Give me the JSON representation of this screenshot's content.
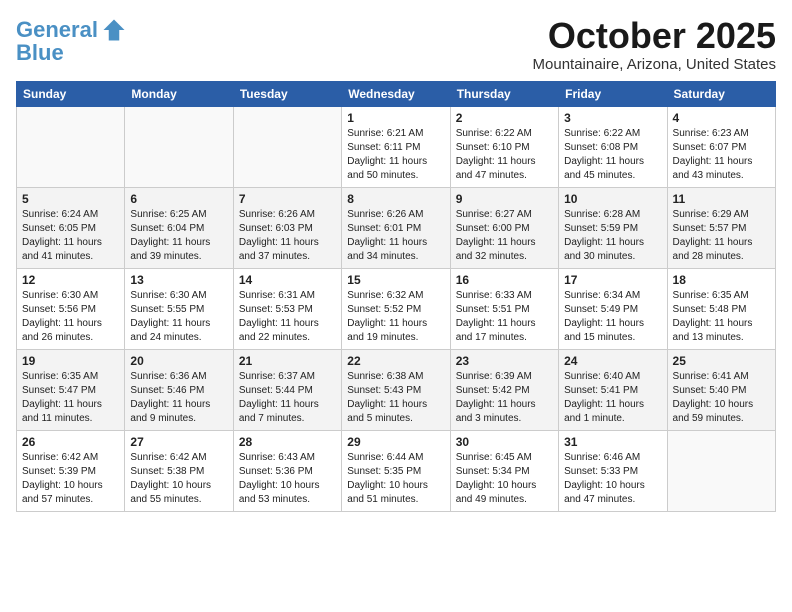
{
  "header": {
    "logo_line1": "General",
    "logo_line2": "Blue",
    "month": "October 2025",
    "location": "Mountainaire, Arizona, United States"
  },
  "weekdays": [
    "Sunday",
    "Monday",
    "Tuesday",
    "Wednesday",
    "Thursday",
    "Friday",
    "Saturday"
  ],
  "weeks": [
    [
      {
        "day": "",
        "info": ""
      },
      {
        "day": "",
        "info": ""
      },
      {
        "day": "",
        "info": ""
      },
      {
        "day": "1",
        "info": "Sunrise: 6:21 AM\nSunset: 6:11 PM\nDaylight: 11 hours\nand 50 minutes."
      },
      {
        "day": "2",
        "info": "Sunrise: 6:22 AM\nSunset: 6:10 PM\nDaylight: 11 hours\nand 47 minutes."
      },
      {
        "day": "3",
        "info": "Sunrise: 6:22 AM\nSunset: 6:08 PM\nDaylight: 11 hours\nand 45 minutes."
      },
      {
        "day": "4",
        "info": "Sunrise: 6:23 AM\nSunset: 6:07 PM\nDaylight: 11 hours\nand 43 minutes."
      }
    ],
    [
      {
        "day": "5",
        "info": "Sunrise: 6:24 AM\nSunset: 6:05 PM\nDaylight: 11 hours\nand 41 minutes."
      },
      {
        "day": "6",
        "info": "Sunrise: 6:25 AM\nSunset: 6:04 PM\nDaylight: 11 hours\nand 39 minutes."
      },
      {
        "day": "7",
        "info": "Sunrise: 6:26 AM\nSunset: 6:03 PM\nDaylight: 11 hours\nand 37 minutes."
      },
      {
        "day": "8",
        "info": "Sunrise: 6:26 AM\nSunset: 6:01 PM\nDaylight: 11 hours\nand 34 minutes."
      },
      {
        "day": "9",
        "info": "Sunrise: 6:27 AM\nSunset: 6:00 PM\nDaylight: 11 hours\nand 32 minutes."
      },
      {
        "day": "10",
        "info": "Sunrise: 6:28 AM\nSunset: 5:59 PM\nDaylight: 11 hours\nand 30 minutes."
      },
      {
        "day": "11",
        "info": "Sunrise: 6:29 AM\nSunset: 5:57 PM\nDaylight: 11 hours\nand 28 minutes."
      }
    ],
    [
      {
        "day": "12",
        "info": "Sunrise: 6:30 AM\nSunset: 5:56 PM\nDaylight: 11 hours\nand 26 minutes."
      },
      {
        "day": "13",
        "info": "Sunrise: 6:30 AM\nSunset: 5:55 PM\nDaylight: 11 hours\nand 24 minutes."
      },
      {
        "day": "14",
        "info": "Sunrise: 6:31 AM\nSunset: 5:53 PM\nDaylight: 11 hours\nand 22 minutes."
      },
      {
        "day": "15",
        "info": "Sunrise: 6:32 AM\nSunset: 5:52 PM\nDaylight: 11 hours\nand 19 minutes."
      },
      {
        "day": "16",
        "info": "Sunrise: 6:33 AM\nSunset: 5:51 PM\nDaylight: 11 hours\nand 17 minutes."
      },
      {
        "day": "17",
        "info": "Sunrise: 6:34 AM\nSunset: 5:49 PM\nDaylight: 11 hours\nand 15 minutes."
      },
      {
        "day": "18",
        "info": "Sunrise: 6:35 AM\nSunset: 5:48 PM\nDaylight: 11 hours\nand 13 minutes."
      }
    ],
    [
      {
        "day": "19",
        "info": "Sunrise: 6:35 AM\nSunset: 5:47 PM\nDaylight: 11 hours\nand 11 minutes."
      },
      {
        "day": "20",
        "info": "Sunrise: 6:36 AM\nSunset: 5:46 PM\nDaylight: 11 hours\nand 9 minutes."
      },
      {
        "day": "21",
        "info": "Sunrise: 6:37 AM\nSunset: 5:44 PM\nDaylight: 11 hours\nand 7 minutes."
      },
      {
        "day": "22",
        "info": "Sunrise: 6:38 AM\nSunset: 5:43 PM\nDaylight: 11 hours\nand 5 minutes."
      },
      {
        "day": "23",
        "info": "Sunrise: 6:39 AM\nSunset: 5:42 PM\nDaylight: 11 hours\nand 3 minutes."
      },
      {
        "day": "24",
        "info": "Sunrise: 6:40 AM\nSunset: 5:41 PM\nDaylight: 11 hours\nand 1 minute."
      },
      {
        "day": "25",
        "info": "Sunrise: 6:41 AM\nSunset: 5:40 PM\nDaylight: 10 hours\nand 59 minutes."
      }
    ],
    [
      {
        "day": "26",
        "info": "Sunrise: 6:42 AM\nSunset: 5:39 PM\nDaylight: 10 hours\nand 57 minutes."
      },
      {
        "day": "27",
        "info": "Sunrise: 6:42 AM\nSunset: 5:38 PM\nDaylight: 10 hours\nand 55 minutes."
      },
      {
        "day": "28",
        "info": "Sunrise: 6:43 AM\nSunset: 5:36 PM\nDaylight: 10 hours\nand 53 minutes."
      },
      {
        "day": "29",
        "info": "Sunrise: 6:44 AM\nSunset: 5:35 PM\nDaylight: 10 hours\nand 51 minutes."
      },
      {
        "day": "30",
        "info": "Sunrise: 6:45 AM\nSunset: 5:34 PM\nDaylight: 10 hours\nand 49 minutes."
      },
      {
        "day": "31",
        "info": "Sunrise: 6:46 AM\nSunset: 5:33 PM\nDaylight: 10 hours\nand 47 minutes."
      },
      {
        "day": "",
        "info": ""
      }
    ]
  ]
}
